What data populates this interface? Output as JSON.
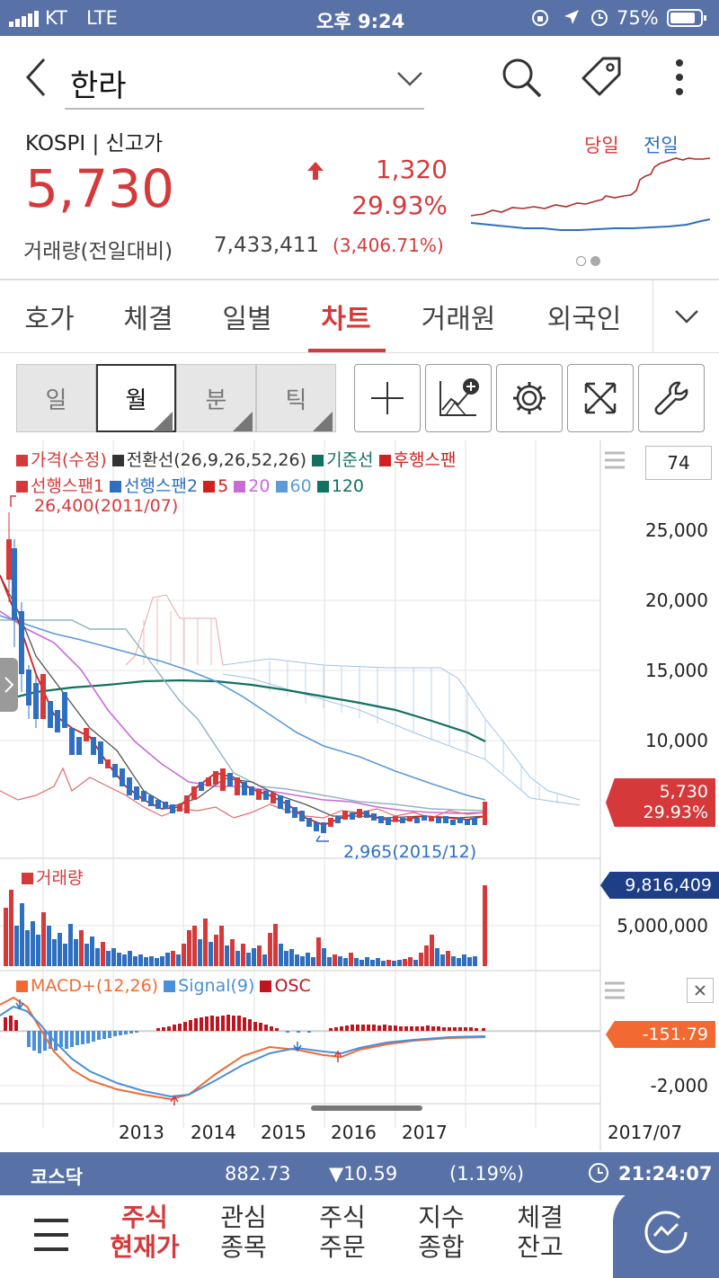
{
  "status": {
    "carrier": "KT",
    "network": "LTE",
    "time": "오후 9:24",
    "battery": "75%"
  },
  "header": {
    "title": "한라"
  },
  "stock": {
    "market": "KOSPI | 신고가",
    "price": "5,730",
    "change": "1,320",
    "change_pct": "29.93%",
    "volume_label": "거래량(전일대비)",
    "volume": "7,433,411",
    "volume_ratio": "(3,406.71%)",
    "mini_today": "당일",
    "mini_prev": "전일"
  },
  "tabs": [
    "호가",
    "체결",
    "일별",
    "차트",
    "거래원",
    "외국인"
  ],
  "active_tab": "차트",
  "periods": [
    "일",
    "월",
    "분",
    "틱"
  ],
  "active_period": "월",
  "chart": {
    "legend_row1": [
      {
        "label": "가격(수정)",
        "color": "#d6393a"
      },
      {
        "label": "전환선(26,9,26,52,26)",
        "color": "#333333"
      },
      {
        "label": "기준선",
        "color": "#12715f"
      },
      {
        "label": "후행스팬",
        "color": "#d21f1f"
      }
    ],
    "legend_row2": [
      {
        "label": "선행스팬1",
        "color": "#d6393a"
      },
      {
        "label": "선행스팬2",
        "color": "#2e6fbf"
      },
      {
        "label": "5",
        "color": "#d21f1f"
      },
      {
        "label": "20",
        "color": "#c86bd6"
      },
      {
        "label": "60",
        "color": "#5c9ad8"
      },
      {
        "label": "120",
        "color": "#12715f"
      }
    ],
    "period_count": "74",
    "high_note": "26,400(2011/07)",
    "low_note": "2,965(2015/12)",
    "y_ticks": [
      "25,000",
      "20,000",
      "15,000",
      "10,000"
    ],
    "price_tag": "5,730",
    "price_tag_pct": "29.93%",
    "volume_title": "거래량",
    "volume_tag": "9,816,409",
    "volume_tick": "5,000,000",
    "macd_legend": [
      {
        "label": "MACD+(12,26)",
        "color": "#f26a32"
      },
      {
        "label": "Signal(9)",
        "color": "#4a90d9"
      },
      {
        "label": "OSC",
        "color": "#c0141e"
      }
    ],
    "macd_tag": "-151.79",
    "macd_tick": "-2,000",
    "x_ticks": [
      "2013",
      "2014",
      "2015",
      "2016",
      "2017"
    ],
    "x_current": "2017/07"
  },
  "ticker": {
    "name": "코스닥",
    "value": "882.73",
    "change": "▼10.59",
    "pct": "(1.19%)",
    "time": "21:24:07"
  },
  "bottom_nav": [
    {
      "line1": "주식",
      "line2": "현재가"
    },
    {
      "line1": "관심",
      "line2": "종목"
    },
    {
      "line1": "주식",
      "line2": "주문"
    },
    {
      "line1": "지수",
      "line2": "종합"
    },
    {
      "line1": "체결",
      "line2": "잔고"
    }
  ]
}
